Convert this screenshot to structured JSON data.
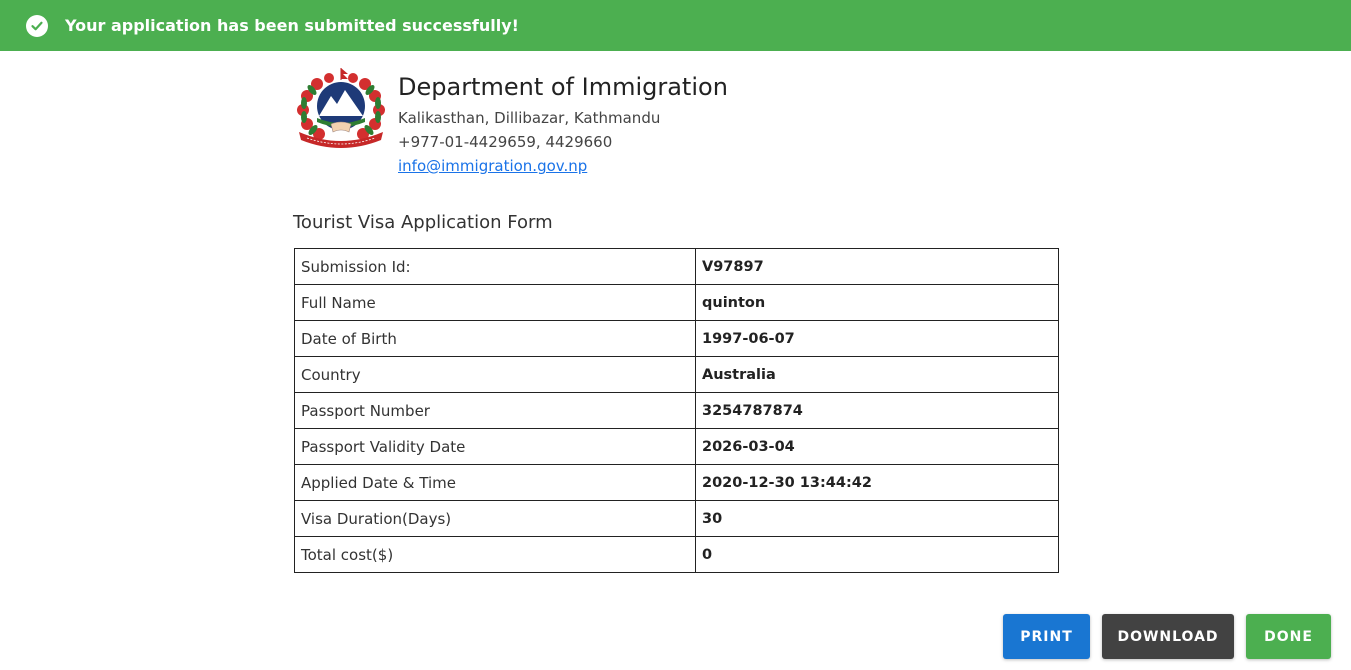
{
  "banner": {
    "message": "Your application has been submitted successfully!",
    "icon": "check-circle-icon",
    "color": "#4caf50"
  },
  "organization": {
    "name": "Department of Immigration",
    "address": "Kalikasthan, Dillibazar, Kathmandu",
    "phone": "+977-01-4429659, 4429660",
    "email": "info@immigration.gov.np",
    "logo": "nepal-government-emblem"
  },
  "form": {
    "title": "Tourist Visa Application Form",
    "rows": [
      {
        "label": "Submission Id:",
        "value": "V97897"
      },
      {
        "label": "Full Name",
        "value": "quinton"
      },
      {
        "label": "Date of Birth",
        "value": "1997-06-07"
      },
      {
        "label": "Country",
        "value": "Australia"
      },
      {
        "label": "Passport Number",
        "value": "3254787874"
      },
      {
        "label": "Passport Validity Date",
        "value": "2026-03-04"
      },
      {
        "label": "Applied Date & Time",
        "value": "2020-12-30 13:44:42"
      },
      {
        "label": "Visa Duration(Days)",
        "value": "30"
      },
      {
        "label": "Total cost($)",
        "value": "0"
      }
    ]
  },
  "actions": {
    "print_label": "PRINT",
    "download_label": "DOWNLOAD",
    "done_label": "DONE",
    "colors": {
      "print": "#1976d2",
      "download": "#424242",
      "done": "#4caf50"
    }
  }
}
